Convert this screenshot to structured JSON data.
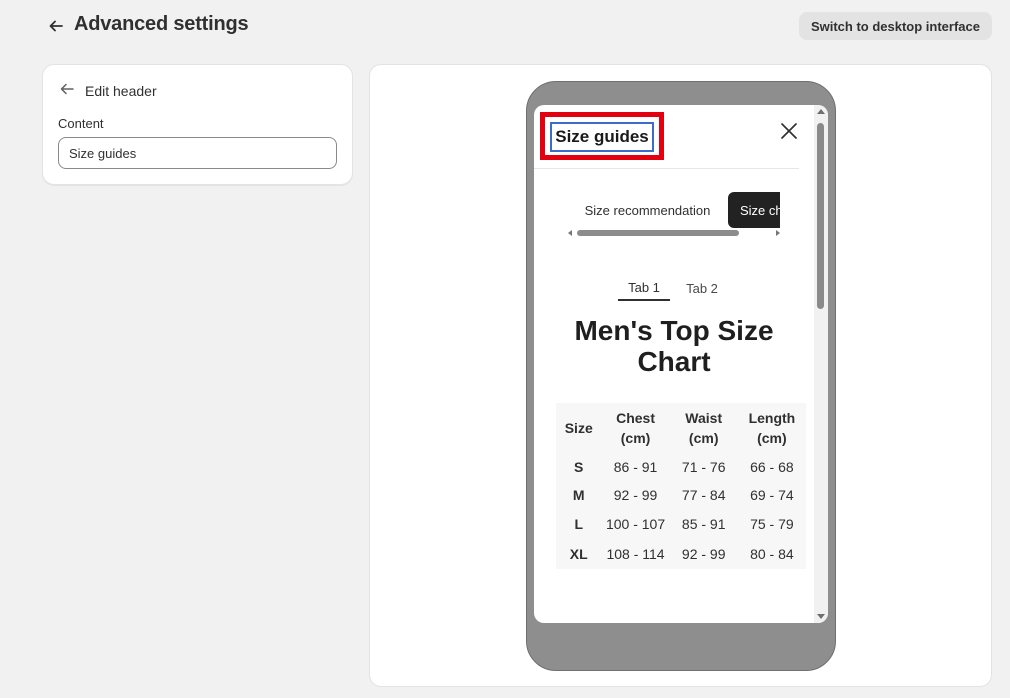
{
  "header": {
    "title": "Advanced settings",
    "back_icon": "arrow-left-icon",
    "switch_button": "Switch to desktop interface"
  },
  "editor": {
    "back_label": "Edit header",
    "content_label": "Content",
    "content_value": "Size guides"
  },
  "preview": {
    "modal_title": "Size guides",
    "close_icon": "close-icon",
    "tabs": [
      "Size recommendation",
      "Size chart"
    ],
    "subtabs": [
      "Tab 1",
      "Tab 2"
    ],
    "chart_title": "Men's Top Size Chart",
    "table": {
      "headers": [
        "Size",
        "Chest (cm)",
        "Waist (cm)",
        "Length (cm)"
      ],
      "rows": [
        [
          "S",
          "86 - 91",
          "71 - 76",
          "66 - 68"
        ],
        [
          "M",
          "92 - 99",
          "77 - 84",
          "69 - 74"
        ],
        [
          "L",
          "100 - 107",
          "85 - 91",
          "75 - 79"
        ],
        [
          "XL",
          "108 - 114",
          "92 - 99",
          "80 - 84"
        ]
      ]
    },
    "highlight_color": "#e3000f",
    "focus_color": "#3b6cc7"
  }
}
